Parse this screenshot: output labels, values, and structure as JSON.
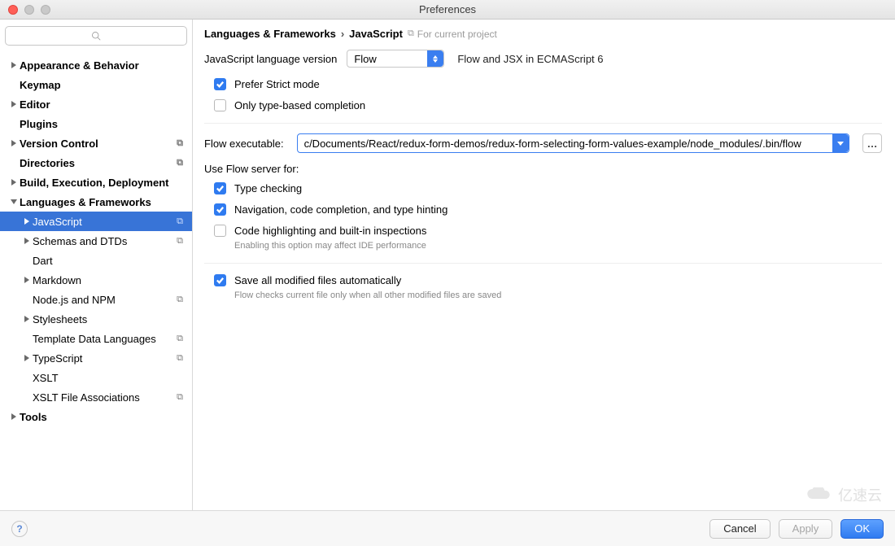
{
  "window": {
    "title": "Preferences"
  },
  "sidebar": {
    "search_placeholder": "",
    "items": [
      {
        "label": "Appearance & Behavior",
        "level": 0,
        "arrow": "right",
        "bold": true
      },
      {
        "label": "Keymap",
        "level": 0,
        "arrow": "",
        "bold": true
      },
      {
        "label": "Editor",
        "level": 0,
        "arrow": "right",
        "bold": true
      },
      {
        "label": "Plugins",
        "level": 0,
        "arrow": "",
        "bold": true
      },
      {
        "label": "Version Control",
        "level": 0,
        "arrow": "right",
        "bold": true,
        "badge": true
      },
      {
        "label": "Directories",
        "level": 0,
        "arrow": "",
        "bold": true,
        "badge": true
      },
      {
        "label": "Build, Execution, Deployment",
        "level": 0,
        "arrow": "right",
        "bold": true
      },
      {
        "label": "Languages & Frameworks",
        "level": 0,
        "arrow": "down",
        "bold": true
      },
      {
        "label": "JavaScript",
        "level": 1,
        "arrow": "right",
        "badge": true,
        "selected": true
      },
      {
        "label": "Schemas and DTDs",
        "level": 1,
        "arrow": "right",
        "badge": true
      },
      {
        "label": "Dart",
        "level": 1,
        "arrow": ""
      },
      {
        "label": "Markdown",
        "level": 1,
        "arrow": "right"
      },
      {
        "label": "Node.js and NPM",
        "level": 1,
        "arrow": "",
        "badge": true
      },
      {
        "label": "Stylesheets",
        "level": 1,
        "arrow": "right"
      },
      {
        "label": "Template Data Languages",
        "level": 1,
        "arrow": "",
        "badge": true
      },
      {
        "label": "TypeScript",
        "level": 1,
        "arrow": "right",
        "badge": true
      },
      {
        "label": "XSLT",
        "level": 1,
        "arrow": ""
      },
      {
        "label": "XSLT File Associations",
        "level": 1,
        "arrow": "",
        "badge": true
      },
      {
        "label": "Tools",
        "level": 0,
        "arrow": "right",
        "bold": true
      }
    ]
  },
  "main": {
    "breadcrumb": [
      "Languages & Frameworks",
      "JavaScript"
    ],
    "scope_label": "For current project",
    "lang_version_label": "JavaScript language version",
    "lang_version_value": "Flow",
    "lang_version_hint": "Flow and JSX in ECMAScript 6",
    "chk_strict": "Prefer Strict mode",
    "chk_types": "Only type-based completion",
    "flow_exe_label": "Flow executable:",
    "flow_exe_value": "c/Documents/React/redux-form-demos/redux-form-selecting-form-values-example/node_modules/.bin/flow",
    "use_flow_label": "Use Flow server for:",
    "chk_typecheck": "Type checking",
    "chk_nav": "Navigation, code completion, and type hinting",
    "chk_hl": "Code highlighting and built-in inspections",
    "chk_hl_sub": "Enabling this option may affect IDE performance",
    "chk_save": "Save all modified files automatically",
    "chk_save_sub": "Flow checks current file only when all other modified files are saved"
  },
  "footer": {
    "help": "?",
    "cancel": "Cancel",
    "apply": "Apply",
    "ok": "OK"
  },
  "watermark": "亿速云"
}
